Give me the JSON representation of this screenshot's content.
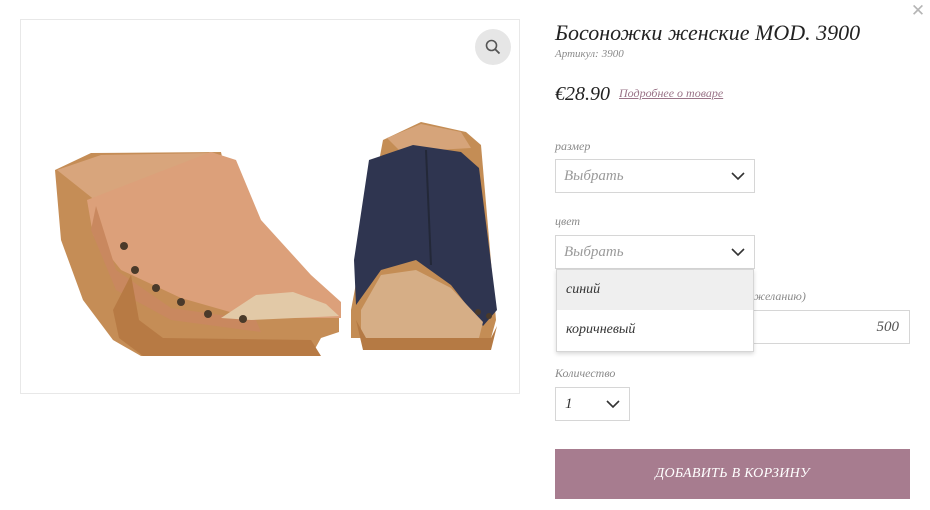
{
  "modal": {
    "close_icon": "close-icon"
  },
  "product": {
    "title": "Босоножки женские MOD. 3900",
    "sku_label": "Артикул:",
    "sku_value": "3900",
    "price": "€28.90",
    "details_link": "Подробнее о товаре",
    "image": {
      "icon": "zoom-icon",
      "left_shoe_color": "#d9a27f",
      "right_shoe_color": "#2f3550",
      "wood_color": "#c48d55"
    }
  },
  "options": {
    "size": {
      "label": "размер",
      "value": "Выбрать"
    },
    "color": {
      "label": "цвет",
      "value": "Выбрать",
      "options": [
        "синий",
        "коричневый"
      ],
      "highlighted": "синий"
    },
    "partial_label": "желанию)",
    "amount_value": "500",
    "quantity": {
      "label": "Количество",
      "value": "1"
    }
  },
  "cart": {
    "add_button": "ДОБАВИТЬ В КОРЗИНУ"
  },
  "colors": {
    "accent": "#a77c8f",
    "link": "#9a7488",
    "border": "#d6d6d6"
  }
}
